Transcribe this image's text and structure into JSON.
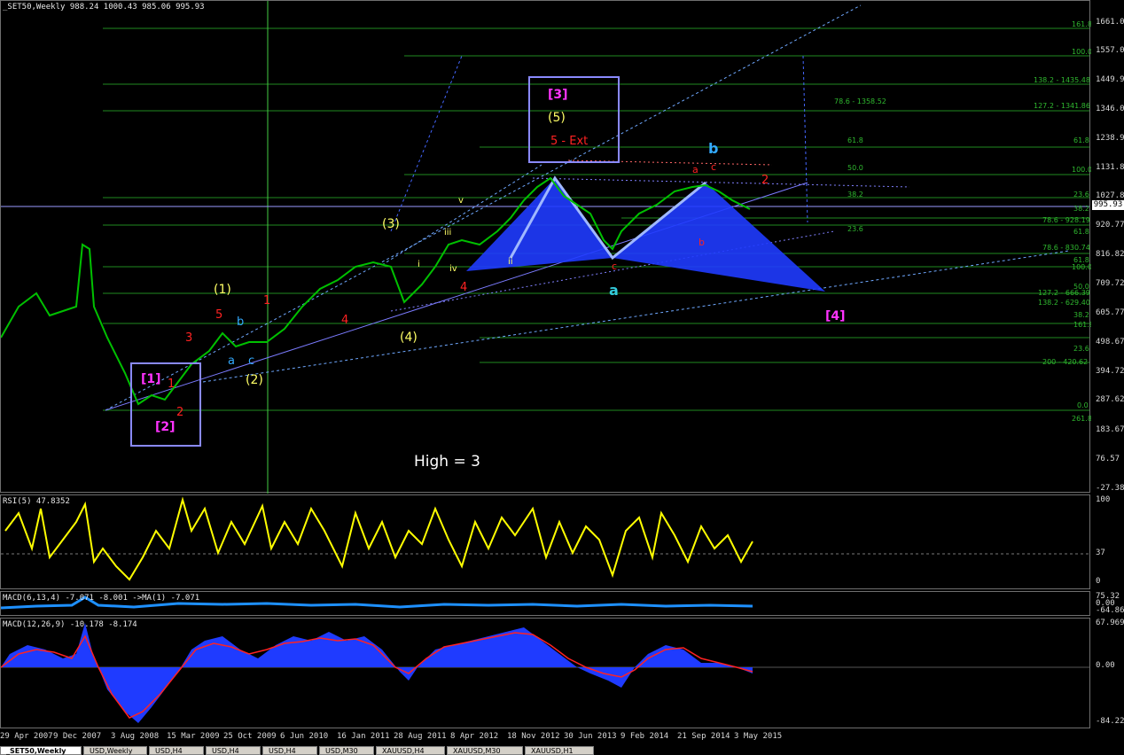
{
  "header": {
    "title": "_SET50,Weekly  988.24 1000.43 985.06 995.93"
  },
  "price_axis": {
    "labels": [
      "1661.01",
      "1557.01",
      "1449.97",
      "1346.01",
      "1238.93",
      "1131.85",
      "1027.87",
      "920.77",
      "816.82",
      "709.72",
      "605.77",
      "498.67",
      "394.72",
      "287.62",
      "183.67",
      "76.57",
      "-27.38"
    ],
    "current_price": "995.93"
  },
  "fib_labels": [
    "161.8",
    "100.0",
    "138.2 - 1435.48",
    "78.6 - 1358.52",
    "127.2 - 1341.86",
    "61.8",
    "61.8",
    "50.0",
    "100.0",
    "38.2",
    "23.6",
    "38.2",
    "78.6 - 928.19",
    "23.6",
    "61.8",
    "78.6 - 830.74",
    "61.8",
    "100.0",
    "50.0",
    "127.2 - 666.39",
    "138.2 - 629.40",
    "38.2",
    "161.8",
    "23.6",
    "200 - 420.62",
    "0.0",
    "261.8"
  ],
  "wave_labels": [
    "[1]",
    "[2]",
    "[3]",
    "(5)",
    "5 - Ext",
    "b",
    "a",
    "[4]",
    "(1)",
    "(2)",
    "(3)",
    "(4)",
    "1",
    "2",
    "3",
    "4",
    "5",
    "a",
    "b",
    "c",
    "i",
    "ii",
    "iii",
    "iv",
    "v",
    "c",
    "a",
    "b",
    "c",
    "2",
    "1",
    "4"
  ],
  "annotation": "High = 3",
  "rsi_panel": {
    "title": "RSI(5) 47.8352",
    "axis_labels": [
      "100",
      "37",
      "0"
    ]
  },
  "macd_small_panel": {
    "title": "MACD(6,13,4) -7.071 -8.001  ->MA(1) -7.071",
    "axis_labels": [
      "75.32",
      "0.00",
      "-64.863"
    ]
  },
  "macd_panel": {
    "title": "MACD(12,26,9) -10.178 -8.174",
    "axis_labels": [
      "67.969",
      "0.00",
      "-84.225"
    ]
  },
  "dates": [
    "29 Apr 2007",
    "9 Dec 2007",
    "3 Aug 2008",
    "15 Mar 2009",
    "25 Oct 2009",
    "6 Jun 2010",
    "16 Jan 2011",
    "28 Aug 2011",
    "8 Apr 2012",
    "18 Nov 2012",
    "30 Jun 2013",
    "9 Feb 2014",
    "21 Sep 2014",
    "3 May 2015"
  ],
  "tabs": [
    "_SET50,Weekly",
    "USD,Weekly",
    "USD,H4",
    "USD,H4",
    "USD,H4",
    "USD,M30",
    "XAUUSD,H4",
    "XAUUSD,M30",
    "XAUUSD,H1"
  ],
  "colors": {
    "background": "#000000",
    "price_bars": "#00c000",
    "fib_lines": "#1f8a1f",
    "rsi_line": "#ffff00",
    "macd_histogram": "#0000ff",
    "signal_line": "#ff0000",
    "pattern_fill": "#1f3bff",
    "box_border": "#8a8aff",
    "label_magenta": "#ff33ff",
    "label_yellow": "#ffff66",
    "label_red": "#ff2222",
    "label_cyan": "#33aaff"
  }
}
